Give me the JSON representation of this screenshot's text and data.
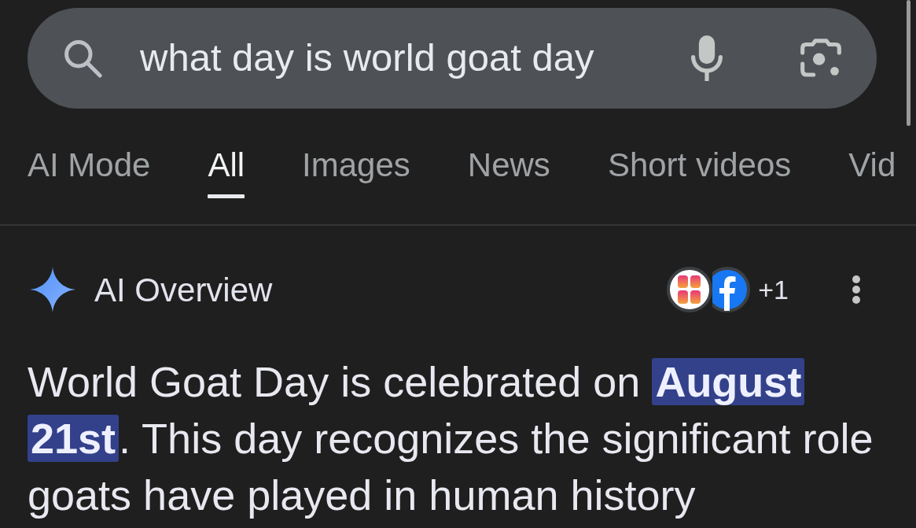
{
  "search": {
    "value": "what day is world goat day"
  },
  "tabs": [
    {
      "label": "AI Mode",
      "selected": false
    },
    {
      "label": "All",
      "selected": true
    },
    {
      "label": "Images",
      "selected": false
    },
    {
      "label": "News",
      "selected": false
    },
    {
      "label": "Short videos",
      "selected": false
    },
    {
      "label": "Vid",
      "selected": false
    }
  ],
  "ai_overview": {
    "title": "AI Overview",
    "more_sources": "+1",
    "paragraph": [
      {
        "text": "World Goat Day is celebrated on ",
        "highlighted": false
      },
      {
        "text": "August 21st",
        "highlighted": true
      },
      {
        "text": ". This day recognizes the significant role goats have played in human history",
        "highlighted": false
      }
    ]
  }
}
